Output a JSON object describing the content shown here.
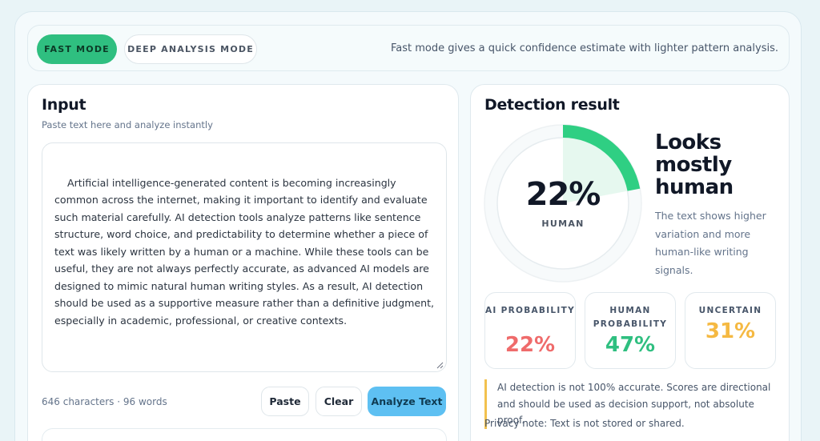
{
  "modes": {
    "fast_label": "FAST MODE",
    "deep_label": "DEEP ANALYSIS MODE",
    "selected": "FAST MODE",
    "description": "Fast mode gives a quick confidence estimate with lighter pattern analysis."
  },
  "input": {
    "title": "Input",
    "subtitle": "Paste text here and analyze instantly",
    "text": "Artificial intelligence-generated content is becoming increasingly common across the internet, making it important to identify and evaluate such material carefully. AI detection tools analyze patterns like sentence structure, word choice, and predictability to determine whether a piece of text was likely written by a human or a machine. While these tools can be useful, they are not always perfectly accurate, as advanced AI models are designed to mimic natural human writing styles. As a result, AI detection should be used as a supportive measure rather than a definitive judgment, especially in academic, professional, or creative contexts.",
    "counter": "646 characters · 96 words",
    "paste_label": "Paste",
    "clear_label": "Clear",
    "analyze_label": "Analyze Text"
  },
  "result": {
    "title": "Detection result",
    "gauge_value": "22%",
    "gauge_fraction": 0.22,
    "gauge_label": "HUMAN",
    "verdict": "Looks mostly human",
    "verdict_desc": "The text shows higher variation and more human-like writing signals.",
    "stats": [
      {
        "label": "AI PROBABILITY",
        "value": "22%",
        "color": "#ef6b6b"
      },
      {
        "label": "HUMAN PROBABILITY",
        "value": "47%",
        "color": "#2fbf80"
      },
      {
        "label": "UNCERTAIN",
        "value": "31%",
        "color": "#f5b942"
      }
    ],
    "note": "AI detection is not 100% accurate. Scores are directional and should be used as decision support, not absolute proof.",
    "privacy": "Privacy note: Text is not stored or shared."
  },
  "colors": {
    "accent_green": "#2fbf80",
    "accent_blue": "#5ec0f2",
    "note_bar": "#f2c14e"
  }
}
